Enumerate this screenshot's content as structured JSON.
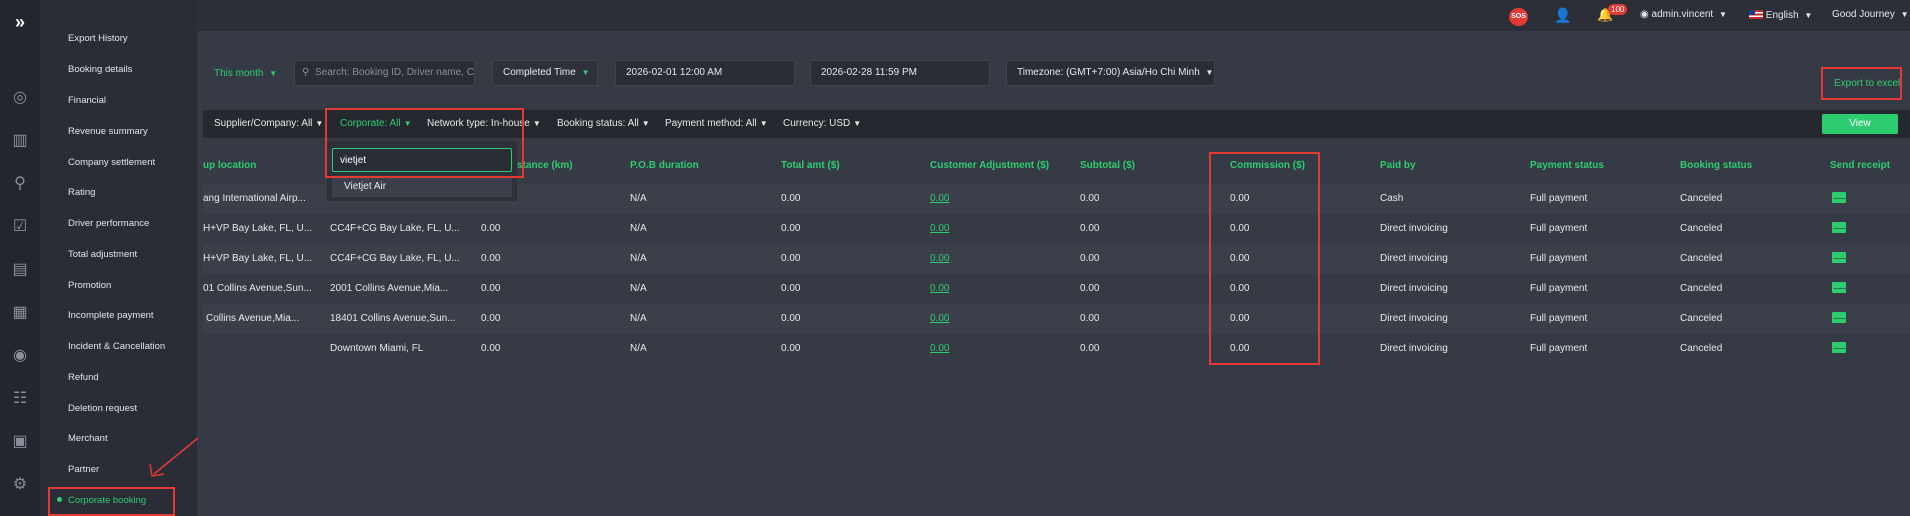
{
  "header": {
    "sos": "SOS",
    "notifications_count": "100",
    "user": "admin.vincent",
    "language": "English",
    "greeting": "Good Journey"
  },
  "submenu": {
    "items": [
      "Export History",
      "Booking details",
      "Financial",
      "Revenue summary",
      "Company settlement",
      "Rating",
      "Driver performance",
      "Total adjustment",
      "Promotion",
      "Incomplete payment",
      "Incident & Cancellation",
      "Refund",
      "Deletion request",
      "Merchant",
      "Partner",
      "Corporate booking"
    ]
  },
  "filters": {
    "period": "This month",
    "search_placeholder": "Search: Booking ID, Driver name, C",
    "time_type": "Completed Time",
    "from_date": "2026-02-01 12:00 AM",
    "to_date": "2026-02-28 11:59 PM",
    "timezone": "Timezone: (GMT+7:00) Asia/Ho Chi Minh",
    "export": "Export to excel"
  },
  "filter_bar": {
    "supplier": "Supplier/Company: All",
    "corporate": "Corporate: All",
    "network": "Network type: In-house",
    "booking_status": "Booking status: All",
    "payment_method": "Payment method: All",
    "currency": "Currency: USD",
    "view": "View"
  },
  "dropdown": {
    "input_value": "vietjet",
    "option": "Vietjet Air"
  },
  "table": {
    "headers": {
      "pickup": "up location",
      "distance": "stance (km)",
      "pob": "P.O.B duration",
      "total": "Total amt ($)",
      "adjustment": "Customer Adjustment ($)",
      "subtotal": "Subtotal ($)",
      "commission": "Commission ($)",
      "paid_by": "Paid by",
      "payment_status": "Payment status",
      "booking_status": "Booking status",
      "receipt": "Send receipt"
    },
    "rows": [
      {
        "pickup": "ang International Airp...",
        "destination": "",
        "distance": "",
        "pob": "N/A",
        "total": "0.00",
        "adjustment": "0.00",
        "subtotal": "0.00",
        "commission": "0.00",
        "paid_by": "Cash",
        "payment_status": "Full payment",
        "booking_status": "Canceled"
      },
      {
        "pickup": "H+VP Bay Lake, FL, U...",
        "destination": "CC4F+CG Bay Lake, FL, U...",
        "distance": "0.00",
        "pob": "N/A",
        "total": "0.00",
        "adjustment": "0.00",
        "subtotal": "0.00",
        "commission": "0.00",
        "paid_by": "Direct invoicing",
        "payment_status": "Full payment",
        "booking_status": "Canceled"
      },
      {
        "pickup": "H+VP Bay Lake, FL, U...",
        "destination": "CC4F+CG Bay Lake, FL, U...",
        "distance": "0.00",
        "pob": "N/A",
        "total": "0.00",
        "adjustment": "0.00",
        "subtotal": "0.00",
        "commission": "0.00",
        "paid_by": "Direct invoicing",
        "payment_status": "Full payment",
        "booking_status": "Canceled"
      },
      {
        "pickup": "01 Collins Avenue,Sun...",
        "destination": "2001 Collins Avenue,Mia...",
        "distance": "0.00",
        "pob": "N/A",
        "total": "0.00",
        "adjustment": "0.00",
        "subtotal": "0.00",
        "commission": "0.00",
        "paid_by": "Direct invoicing",
        "payment_status": "Full payment",
        "booking_status": "Canceled"
      },
      {
        "pickup": "Collins Avenue,Mia...",
        "destination": "18401 Collins Avenue,Sun...",
        "distance": "0.00",
        "pob": "N/A",
        "total": "0.00",
        "adjustment": "0.00",
        "subtotal": "0.00",
        "commission": "0.00",
        "paid_by": "Direct invoicing",
        "payment_status": "Full payment",
        "booking_status": "Canceled"
      },
      {
        "pickup": "",
        "destination": "Downtown Miami, FL",
        "distance": "0.00",
        "pob": "N/A",
        "total": "0.00",
        "adjustment": "0.00",
        "subtotal": "0.00",
        "commission": "0.00",
        "paid_by": "Direct invoicing",
        "payment_status": "Full payment",
        "booking_status": "Canceled"
      }
    ]
  },
  "colors": {
    "accent": "#2ecc71",
    "highlight": "#e53935",
    "background": "#363a45"
  }
}
